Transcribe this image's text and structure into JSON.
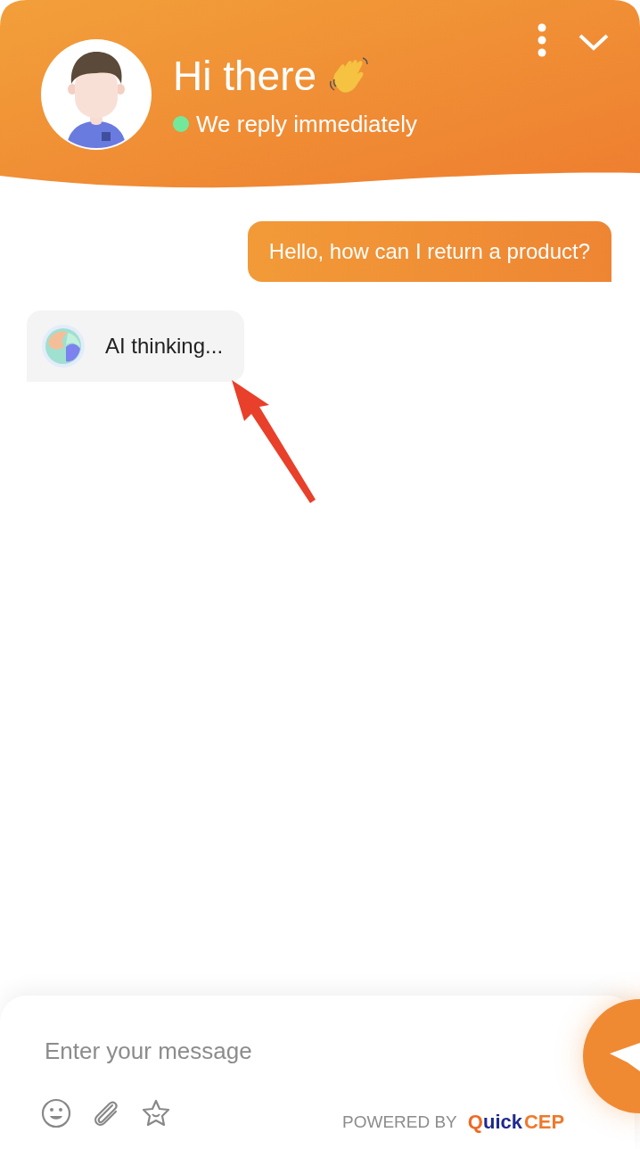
{
  "header": {
    "title": "Hi there",
    "status": {
      "text": "We reply immediately",
      "color": "#74e89a"
    }
  },
  "messages": [
    {
      "kind": "user",
      "text": "Hello, how can I return a product?"
    },
    {
      "kind": "bot",
      "text": "AI thinking..."
    }
  ],
  "composer": {
    "placeholder": "Enter your message",
    "powered_by": "POWERED BY",
    "brand": {
      "mark": "Q",
      "name": "uick",
      "suffix": "CEP"
    }
  }
}
